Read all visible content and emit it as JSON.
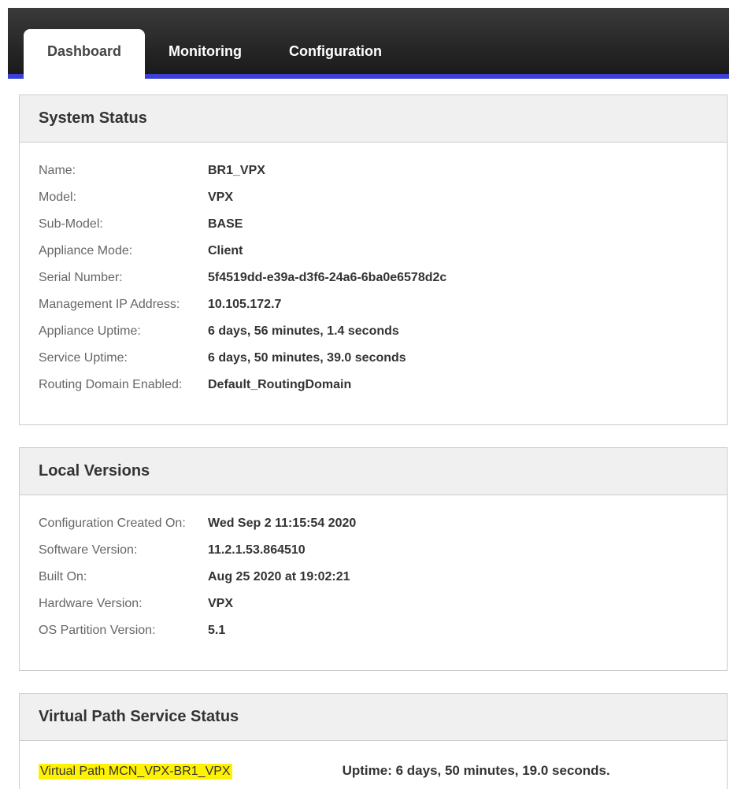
{
  "tabs": {
    "dashboard": "Dashboard",
    "monitoring": "Monitoring",
    "configuration": "Configuration"
  },
  "systemStatus": {
    "title": "System Status",
    "fields": {
      "name_label": "Name:",
      "name_value": "BR1_VPX",
      "model_label": "Model:",
      "model_value": "VPX",
      "submodel_label": "Sub-Model:",
      "submodel_value": "BASE",
      "appmode_label": "Appliance Mode:",
      "appmode_value": "Client",
      "serial_label": "Serial Number:",
      "serial_value": "5f4519dd-e39a-d3f6-24a6-6ba0e6578d2c",
      "mgmtip_label": "Management IP Address:",
      "mgmtip_value": "10.105.172.7",
      "auptime_label": "Appliance Uptime:",
      "auptime_value": "6 days, 56 minutes, 1.4 seconds",
      "suptime_label": "Service Uptime:",
      "suptime_value": "6 days, 50 minutes, 39.0 seconds",
      "routing_label": "Routing Domain Enabled:",
      "routing_value": "Default_RoutingDomain"
    }
  },
  "localVersions": {
    "title": "Local Versions",
    "fields": {
      "config_label": "Configuration Created On:",
      "config_value": "Wed Sep 2 11:15:54 2020",
      "swver_label": "Software Version:",
      "swver_value": "11.2.1.53.864510",
      "built_label": "Built On:",
      "built_value": "Aug 25 2020 at 19:02:21",
      "hwver_label": "Hardware Version:",
      "hwver_value": "VPX",
      "ospart_label": "OS Partition Version:",
      "ospart_value": "5.1"
    }
  },
  "virtualPath": {
    "title": "Virtual Path Service Status",
    "path_label": "Virtual Path MCN_VPX-BR1_VPX",
    "uptime_label": "Uptime: 6 days, 50 minutes, 19.0 seconds."
  }
}
